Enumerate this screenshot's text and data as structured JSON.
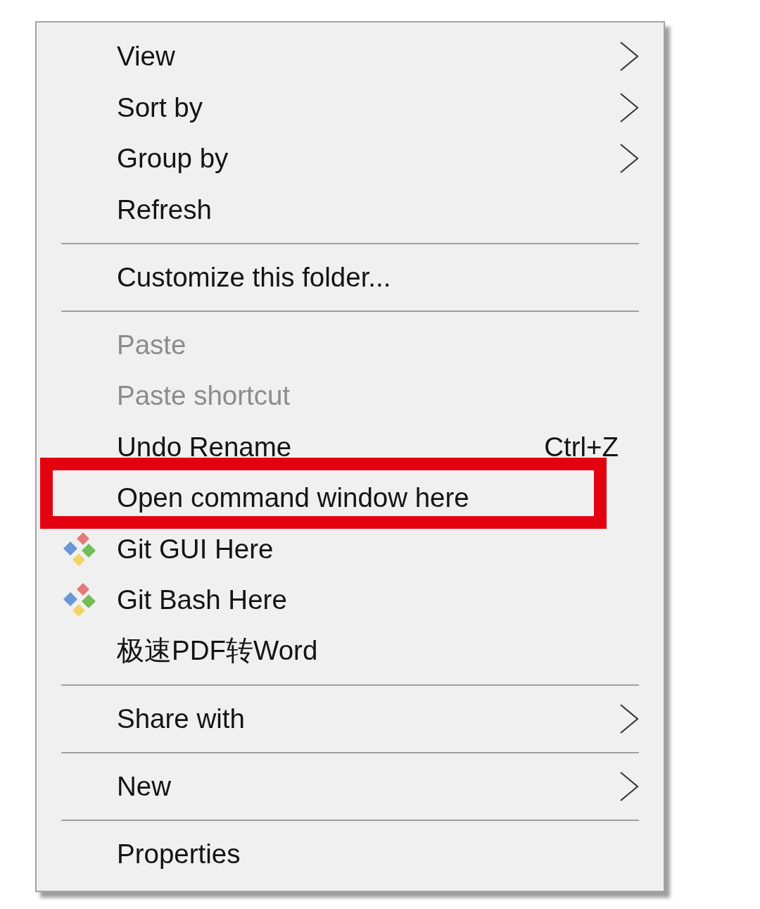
{
  "context_menu": {
    "sections": [
      {
        "items": [
          {
            "label": "View",
            "disabled": false,
            "submenu": true,
            "icon": false,
            "highlighted": false
          },
          {
            "label": "Sort by",
            "disabled": false,
            "submenu": true,
            "icon": false,
            "highlighted": false
          },
          {
            "label": "Group by",
            "disabled": false,
            "submenu": true,
            "icon": false,
            "highlighted": false
          },
          {
            "label": "Refresh",
            "disabled": false,
            "submenu": false,
            "icon": false,
            "highlighted": false
          }
        ]
      },
      {
        "items": [
          {
            "label": "Customize this folder...",
            "disabled": false,
            "submenu": false,
            "icon": false,
            "highlighted": false
          }
        ]
      },
      {
        "items": [
          {
            "label": "Paste",
            "disabled": true,
            "submenu": false,
            "icon": false,
            "highlighted": false
          },
          {
            "label": "Paste shortcut",
            "disabled": true,
            "submenu": false,
            "icon": false,
            "highlighted": false
          },
          {
            "label": "Undo Rename",
            "shortcut": "Ctrl+Z",
            "disabled": false,
            "submenu": false,
            "icon": false,
            "highlighted": false
          },
          {
            "label": "Open command window here",
            "disabled": false,
            "submenu": false,
            "icon": false,
            "highlighted": true
          },
          {
            "label": "Git GUI Here",
            "disabled": false,
            "submenu": false,
            "icon": true,
            "highlighted": false
          },
          {
            "label": "Git Bash Here",
            "disabled": false,
            "submenu": false,
            "icon": true,
            "highlighted": false
          },
          {
            "label": "极速PDF转Word",
            "disabled": false,
            "submenu": false,
            "icon": false,
            "highlighted": false
          }
        ]
      },
      {
        "items": [
          {
            "label": "Share with",
            "disabled": false,
            "submenu": true,
            "icon": false,
            "highlighted": false
          }
        ]
      },
      {
        "items": [
          {
            "label": "New",
            "disabled": false,
            "submenu": true,
            "icon": false,
            "highlighted": false
          }
        ]
      },
      {
        "items": [
          {
            "label": "Properties",
            "disabled": false,
            "submenu": false,
            "icon": false,
            "highlighted": false
          }
        ]
      }
    ]
  }
}
